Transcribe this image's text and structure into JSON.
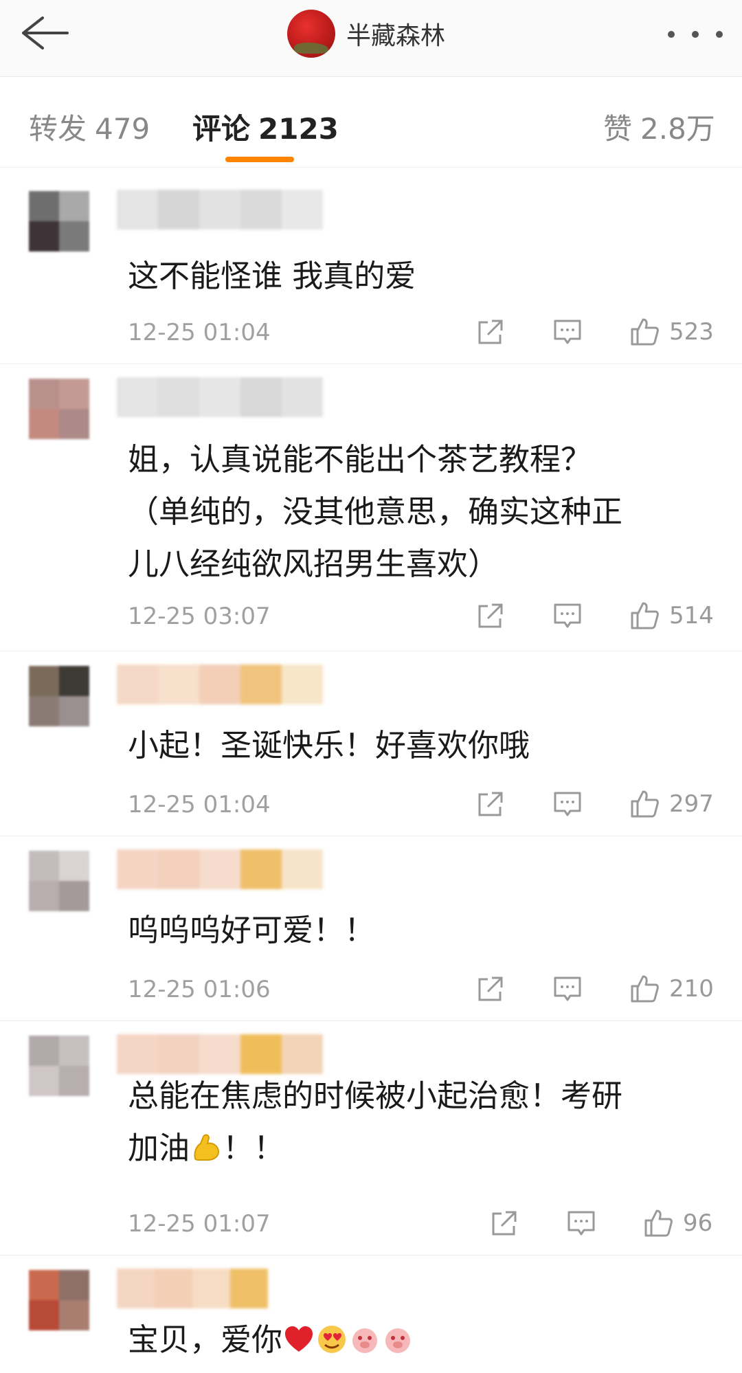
{
  "header": {
    "account_name": "半藏森林",
    "back_icon": "back-arrow-icon",
    "more_icon": "more-dots-icon"
  },
  "tabs": [
    {
      "label": "转发",
      "count": "479",
      "active": false
    },
    {
      "label": "评论",
      "count": "2123",
      "active": true
    },
    {
      "label": "赞",
      "count": "2.8万",
      "active": false
    }
  ],
  "accent_color": "#ff8200",
  "comments": [
    {
      "text": "这不能怪谁 我真的爱",
      "time": "12-25 01:04",
      "likes": "523"
    },
    {
      "text": "姐，认真说能不能出个茶艺教程？（单纯的，没其他意思，确实这种正儿八经纯欲风招男生喜欢）",
      "line1": "姐，认真说能不能出个茶艺教程？",
      "line2": "（单纯的，没其他意思，确实这种正",
      "line3": "儿八经纯欲风招男生喜欢）",
      "time": "12-25 03:07",
      "likes": "514"
    },
    {
      "text": "小起！圣诞快乐！好喜欢你哦",
      "time": "12-25 01:04",
      "likes": "297"
    },
    {
      "text": "呜呜呜好可爱！！",
      "time": "12-25 01:06",
      "likes": "210"
    },
    {
      "text": "总能在焦虑的时候被小起治愈！考研加油💪！！",
      "line1": "总能在焦虑的时候被小起治愈！考研",
      "line2": "加油",
      "line2_end": "！！",
      "time": "12-25 01:07",
      "likes": "96"
    },
    {
      "text": "宝贝，爱你❤😍🐷🐷",
      "line1": "宝贝，爱你"
    }
  ],
  "icons": {
    "share": "share-icon",
    "comment": "comment-icon",
    "like": "thumbs-up-icon"
  }
}
